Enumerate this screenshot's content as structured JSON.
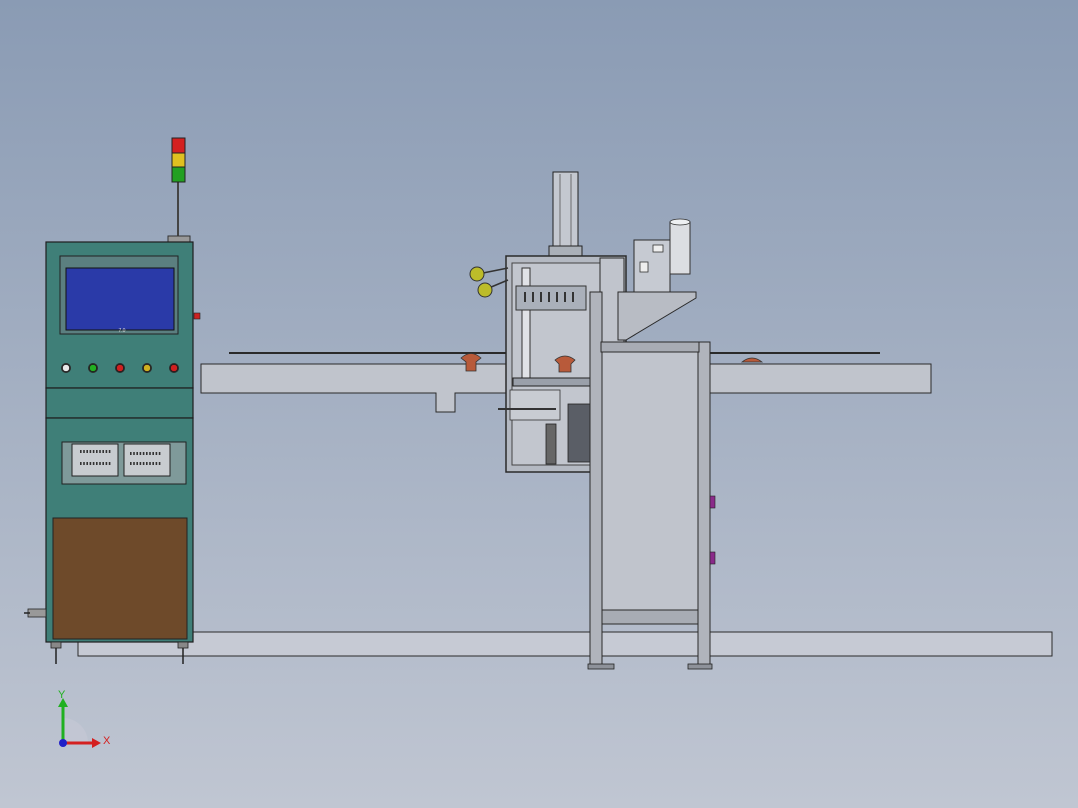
{
  "viewport": {
    "background_top": "#8a9bb4",
    "background_bottom": "#c0c6d2"
  },
  "control_cabinet": {
    "body_color": "#3f7f78",
    "screen_color": "#2a3aa8",
    "door_color": "#6e4a2a",
    "screen_caption": "7.0",
    "stack_light": {
      "lamps": [
        "red",
        "yellow",
        "green"
      ],
      "colors": [
        "#d42020",
        "#e0c020",
        "#22a022"
      ]
    },
    "buttons": [
      {
        "name": "white",
        "color": "#e8e8e8"
      },
      {
        "name": "green",
        "color": "#22b022"
      },
      {
        "name": "red",
        "color": "#d02020"
      },
      {
        "name": "yellow",
        "color": "#d0b020"
      },
      {
        "name": "red-2",
        "color": "#d02020"
      }
    ]
  },
  "machine": {
    "frame_color": "#b8bcc4",
    "stroke_color": "#2a2a2a",
    "knob_color": "#bcbc2a",
    "stopper_color": "#b85a3a"
  },
  "triad": {
    "x_label": "X",
    "y_label": "Y",
    "x_color": "#d42020",
    "y_color": "#20b020",
    "z_color": "#2020c8"
  }
}
